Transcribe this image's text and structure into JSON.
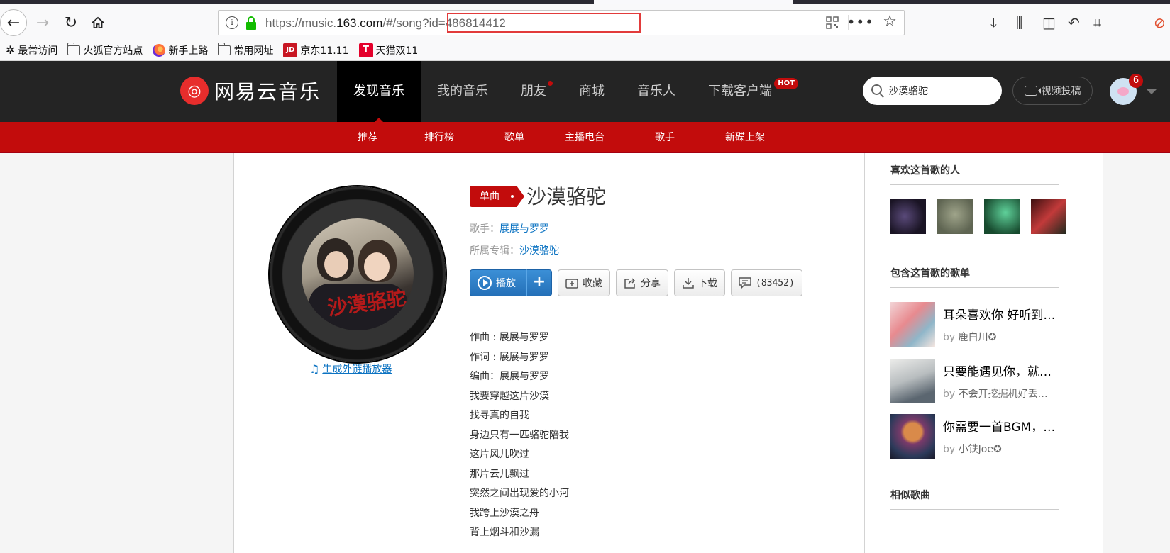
{
  "browser": {
    "url_prefix": "https://music.",
    "url_domain": "163.com",
    "url_rest": "/#/song?id=486814412",
    "bookmarks": [
      {
        "label": "最常访问",
        "icon": "gear-icon"
      },
      {
        "label": "火狐官方站点",
        "icon": "folder-icon"
      },
      {
        "label": "新手上路",
        "icon": "firefox-icon"
      },
      {
        "label": "常用网址",
        "icon": "folder-icon"
      },
      {
        "label": "京东11.11",
        "icon": "jd-icon",
        "icon_text": "JD"
      },
      {
        "label": "天猫双11",
        "icon": "tmall-icon",
        "icon_text": "T"
      }
    ]
  },
  "site": {
    "logo_mark": "◎",
    "logo_text": "网易云音乐",
    "nav": [
      {
        "label": "发现音乐",
        "active": true
      },
      {
        "label": "我的音乐"
      },
      {
        "label": "朋友",
        "dot": true
      },
      {
        "label": "商城"
      },
      {
        "label": "音乐人"
      },
      {
        "label": "下载客户端",
        "hot": "HOT"
      }
    ],
    "search_value": "沙漠骆驼",
    "upload_label": "视频投稿",
    "notification_count": "6",
    "subnav": [
      "推荐",
      "排行榜",
      "歌单",
      "主播电台",
      "歌手",
      "新碟上架"
    ],
    "accent_color": "#c20c0c"
  },
  "song": {
    "tag": "单曲",
    "title": "沙漠骆驼",
    "singer_label": "歌手：",
    "singer": "展展与罗罗",
    "album_label": "所属专辑：",
    "album": "沙漠骆驼",
    "cover_text": "沙漠骆驼",
    "ext_player_link": "生成外链播放器",
    "buttons": {
      "play": "播放",
      "add": "+",
      "collect": "收藏",
      "share": "分享",
      "download": "下载",
      "comments": "(83452)"
    },
    "lyrics": [
      "作曲 : 展展与罗罗",
      "作词 : 展展与罗罗",
      "编曲：展展与罗罗",
      "我要穿越这片沙漠",
      "找寻真的自我",
      "身边只有一匹骆驼陪我",
      "这片风儿吹过",
      "那片云儿飘过",
      "突然之间出现爱的小河",
      "我跨上沙漠之舟",
      "背上烟斗和沙漏"
    ]
  },
  "sidebar": {
    "fans_title": "喜欢这首歌的人",
    "playlists_title": "包含这首歌的歌单",
    "similar_title": "相似歌曲",
    "playlists": [
      {
        "name": "耳朵喜欢你 好听到…",
        "by_label": "by",
        "creator": "鹿白川",
        "vip": "✪"
      },
      {
        "name": "只要能遇见你，就不…",
        "by_label": "by",
        "creator": "不会开挖掘机好丢…",
        "vip": ""
      },
      {
        "name": "你需要一首BGM，…",
        "by_label": "by",
        "creator": "小铁Joe",
        "vip": "✪"
      }
    ]
  }
}
